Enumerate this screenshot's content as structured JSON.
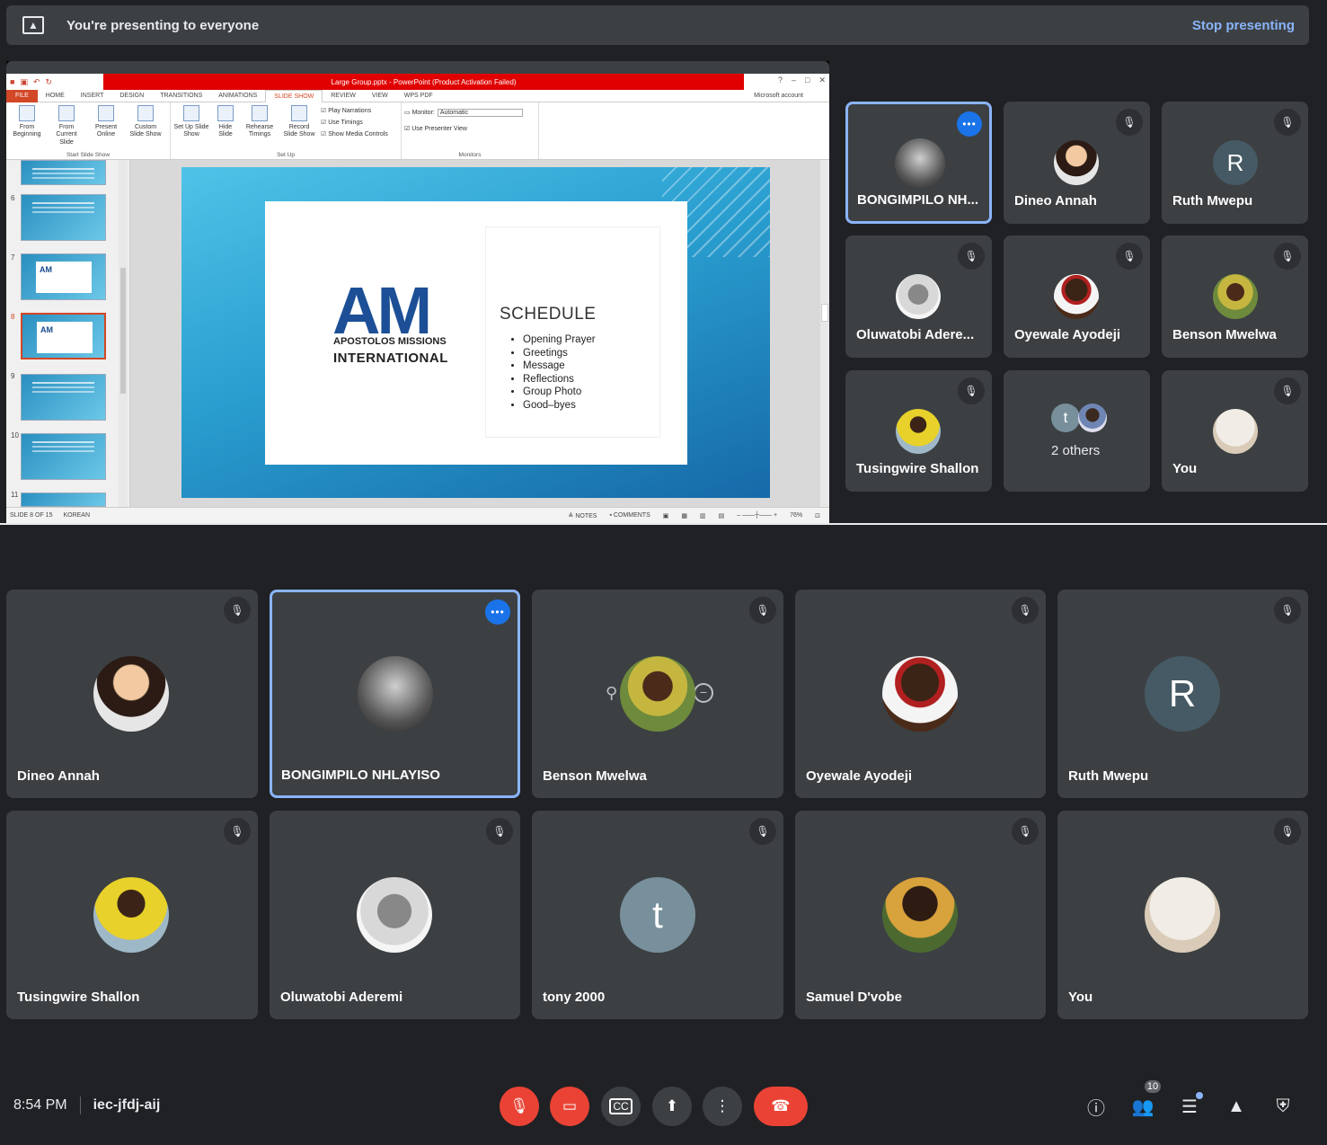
{
  "banner": {
    "message": "You're presenting to everyone",
    "stop_label": "Stop presenting"
  },
  "ppt": {
    "window_title": "Large Group.pptx - PowerPoint (Product Activation Failed)",
    "tabs": [
      "FILE",
      "HOME",
      "INSERT",
      "DESIGN",
      "TRANSITIONS",
      "ANIMATIONS",
      "SLIDE SHOW",
      "REVIEW",
      "VIEW",
      "WPS PDF"
    ],
    "active_tab": "SLIDE SHOW",
    "account": "Microsoft account",
    "ribbon": {
      "from_beginning": "From Beginning",
      "from_current": "From Current Slide",
      "present_online": "Present Online",
      "custom_show": "Custom Slide Show",
      "group1": "Start Slide Show",
      "set_up_show": "Set Up Slide Show",
      "hide_slide": "Hide Slide",
      "rehearse": "Rehearse Timings",
      "record": "Record Slide Show",
      "play_narrations": "Play Narrations",
      "use_timings": "Use Timings",
      "show_media": "Show Media Controls",
      "group2": "Set Up",
      "monitor_label": "Monitor:",
      "monitor_value": "Automatic",
      "presenter_view": "Use Presenter View",
      "group3": "Monitors"
    },
    "thumb_numbers": [
      "6",
      "7",
      "8",
      "9",
      "10",
      "11"
    ],
    "slide": {
      "logo": "AM",
      "org_line1": "APOSTOLOS MISSIONS",
      "org_line2": "INTERNATIONAL",
      "schedule_title": "SCHEDULE",
      "schedule_items": [
        "Opening Prayer",
        "Greetings",
        "Message",
        "Reflections",
        "Group Photo",
        "Good–byes"
      ]
    },
    "status": {
      "slide_of": "SLIDE 8 OF 15",
      "language": "KOREAN",
      "notes": "NOTES",
      "comments": "COMMENTS",
      "zoom": "76%"
    }
  },
  "side_tiles": [
    {
      "name": "BONGIMPILO NH..."
    },
    {
      "name": "Dineo Annah"
    },
    {
      "name": "Ruth Mwepu",
      "initial": "R"
    },
    {
      "name": "Oluwatobi Adere..."
    },
    {
      "name": "Oyewale Ayodeji"
    },
    {
      "name": "Benson Mwelwa"
    },
    {
      "name": "Tusingwire Shallon"
    },
    {
      "name": "2 others",
      "initial": "t"
    },
    {
      "name": "You"
    }
  ],
  "grid_tiles": [
    {
      "name": "Dineo Annah"
    },
    {
      "name": "BONGIMPILO NHLAYISO"
    },
    {
      "name": "Benson Mwelwa"
    },
    {
      "name": "Oyewale Ayodeji"
    },
    {
      "name": "Ruth Mwepu",
      "initial": "R"
    },
    {
      "name": "Tusingwire Shallon"
    },
    {
      "name": "Oluwatobi Aderemi"
    },
    {
      "name": "tony 2000",
      "initial": "t"
    },
    {
      "name": "Samuel D'vobe"
    },
    {
      "name": "You"
    }
  ],
  "bottom": {
    "time": "8:54 PM",
    "meeting_code": "iec-jfdj-aij",
    "participants_count": "10"
  },
  "colors": {
    "background": "#202124",
    "tile": "#3c4043",
    "accent_blue": "#8ab4f8",
    "red": "#ea4335"
  }
}
